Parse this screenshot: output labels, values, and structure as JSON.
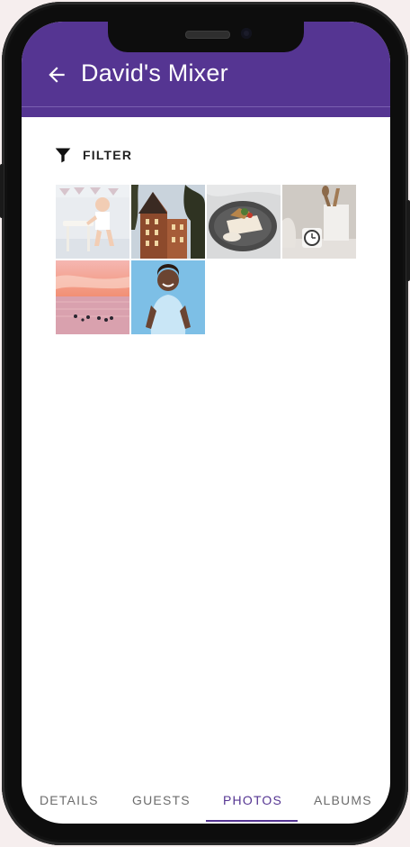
{
  "app_bar": {
    "title": "David's Mixer",
    "back_icon": "arrow-left-icon",
    "color": "#553592"
  },
  "filter": {
    "icon": "filter-funnel-icon",
    "label": "FILTER"
  },
  "photos": [
    {
      "subject": "baby-standing-at-stool"
    },
    {
      "subject": "brick-building-with-trees"
    },
    {
      "subject": "plate-of-food"
    },
    {
      "subject": "kitchen-utensils-and-clock"
    },
    {
      "subject": "sunset-beach-surfers"
    },
    {
      "subject": "smiling-boy-blue-background"
    }
  ],
  "tabs": [
    {
      "label": "DETAILS",
      "active": false
    },
    {
      "label": "GUESTS",
      "active": false
    },
    {
      "label": "PHOTOS",
      "active": true
    },
    {
      "label": "ALBUMS",
      "active": false
    }
  ],
  "colors": {
    "accent": "#553592",
    "tab_inactive": "#6c6c6c",
    "page_background": "#f6eeee"
  }
}
